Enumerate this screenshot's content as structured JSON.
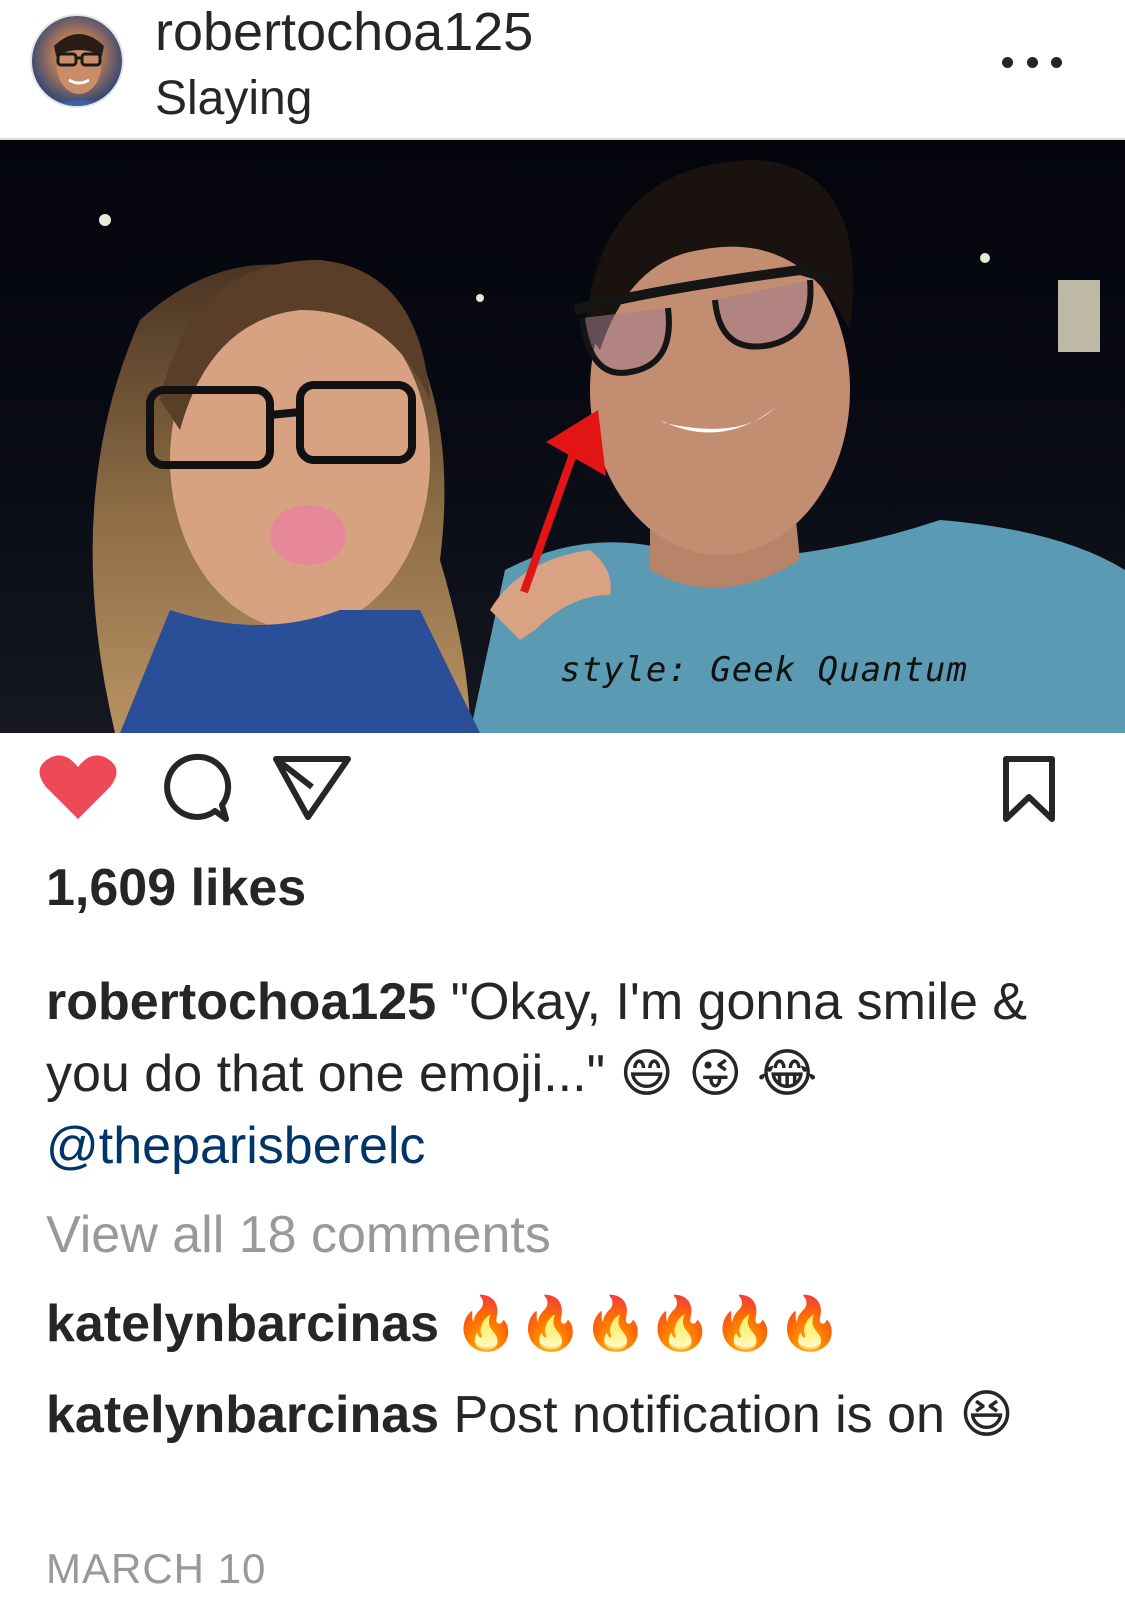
{
  "header": {
    "username": "robertochoa125",
    "location": "Slaying"
  },
  "photo": {
    "overlay_text": "style: Geek Quantum"
  },
  "actions": {
    "like_state": "liked",
    "like_color": "#ed4956"
  },
  "likes": "1,609 likes",
  "caption": {
    "username": "robertochoa125",
    "text": " \"Okay, I'm gonna smile & you do that one emoji...\" 😄 😜 😂",
    "mention": "@theparisberelc"
  },
  "view_comments": "View all 18 comments",
  "comments": [
    {
      "username": "katelynbarcinas",
      "text": " 🔥🔥🔥🔥🔥🔥"
    },
    {
      "username": "katelynbarcinas",
      "text": " Post notification is on 😆"
    }
  ],
  "date": "MARCH 10"
}
